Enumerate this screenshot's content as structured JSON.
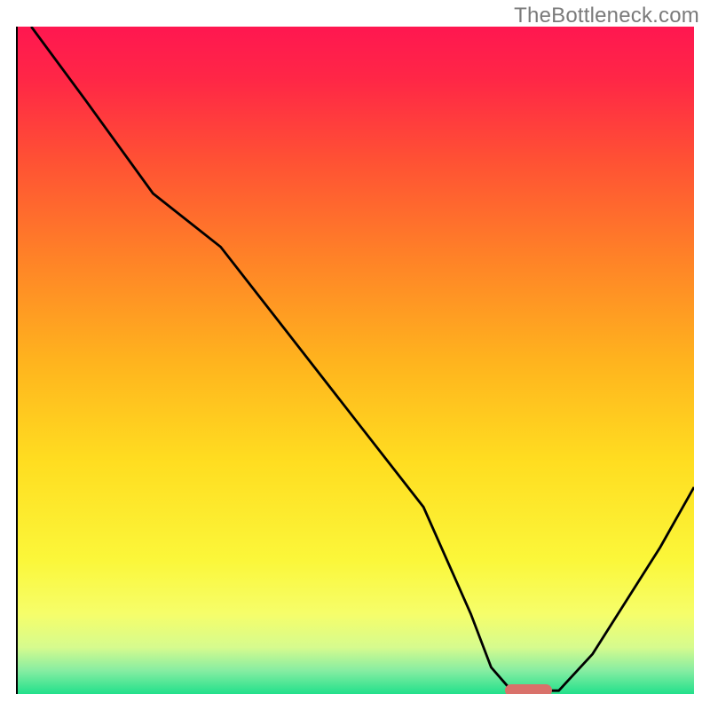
{
  "watermark": "TheBottleneck.com",
  "chart_data": {
    "type": "line",
    "title": "",
    "xlabel": "",
    "ylabel": "",
    "xlim": [
      0,
      100
    ],
    "ylim": [
      0,
      100
    ],
    "x": [
      2,
      10,
      20,
      30,
      40,
      50,
      60,
      67,
      70,
      73,
      76,
      80,
      85,
      90,
      95,
      100
    ],
    "y": [
      100,
      89,
      75,
      67,
      54,
      41,
      28,
      12,
      4,
      0.5,
      0.5,
      0.5,
      6,
      14,
      22,
      31
    ],
    "optimum_region": {
      "x_start": 72,
      "x_end": 79,
      "y": 0.5
    },
    "gradient_stops": [
      {
        "pos": 0.0,
        "color": "#ff1750"
      },
      {
        "pos": 0.08,
        "color": "#ff2746"
      },
      {
        "pos": 0.2,
        "color": "#ff5134"
      },
      {
        "pos": 0.35,
        "color": "#ff8327"
      },
      {
        "pos": 0.5,
        "color": "#ffb31e"
      },
      {
        "pos": 0.65,
        "color": "#ffdd20"
      },
      {
        "pos": 0.8,
        "color": "#fbf73a"
      },
      {
        "pos": 0.88,
        "color": "#f6fe6a"
      },
      {
        "pos": 0.93,
        "color": "#d6fb8e"
      },
      {
        "pos": 0.965,
        "color": "#86eda2"
      },
      {
        "pos": 1.0,
        "color": "#22e08b"
      }
    ],
    "marker_color": "#d9716a"
  }
}
